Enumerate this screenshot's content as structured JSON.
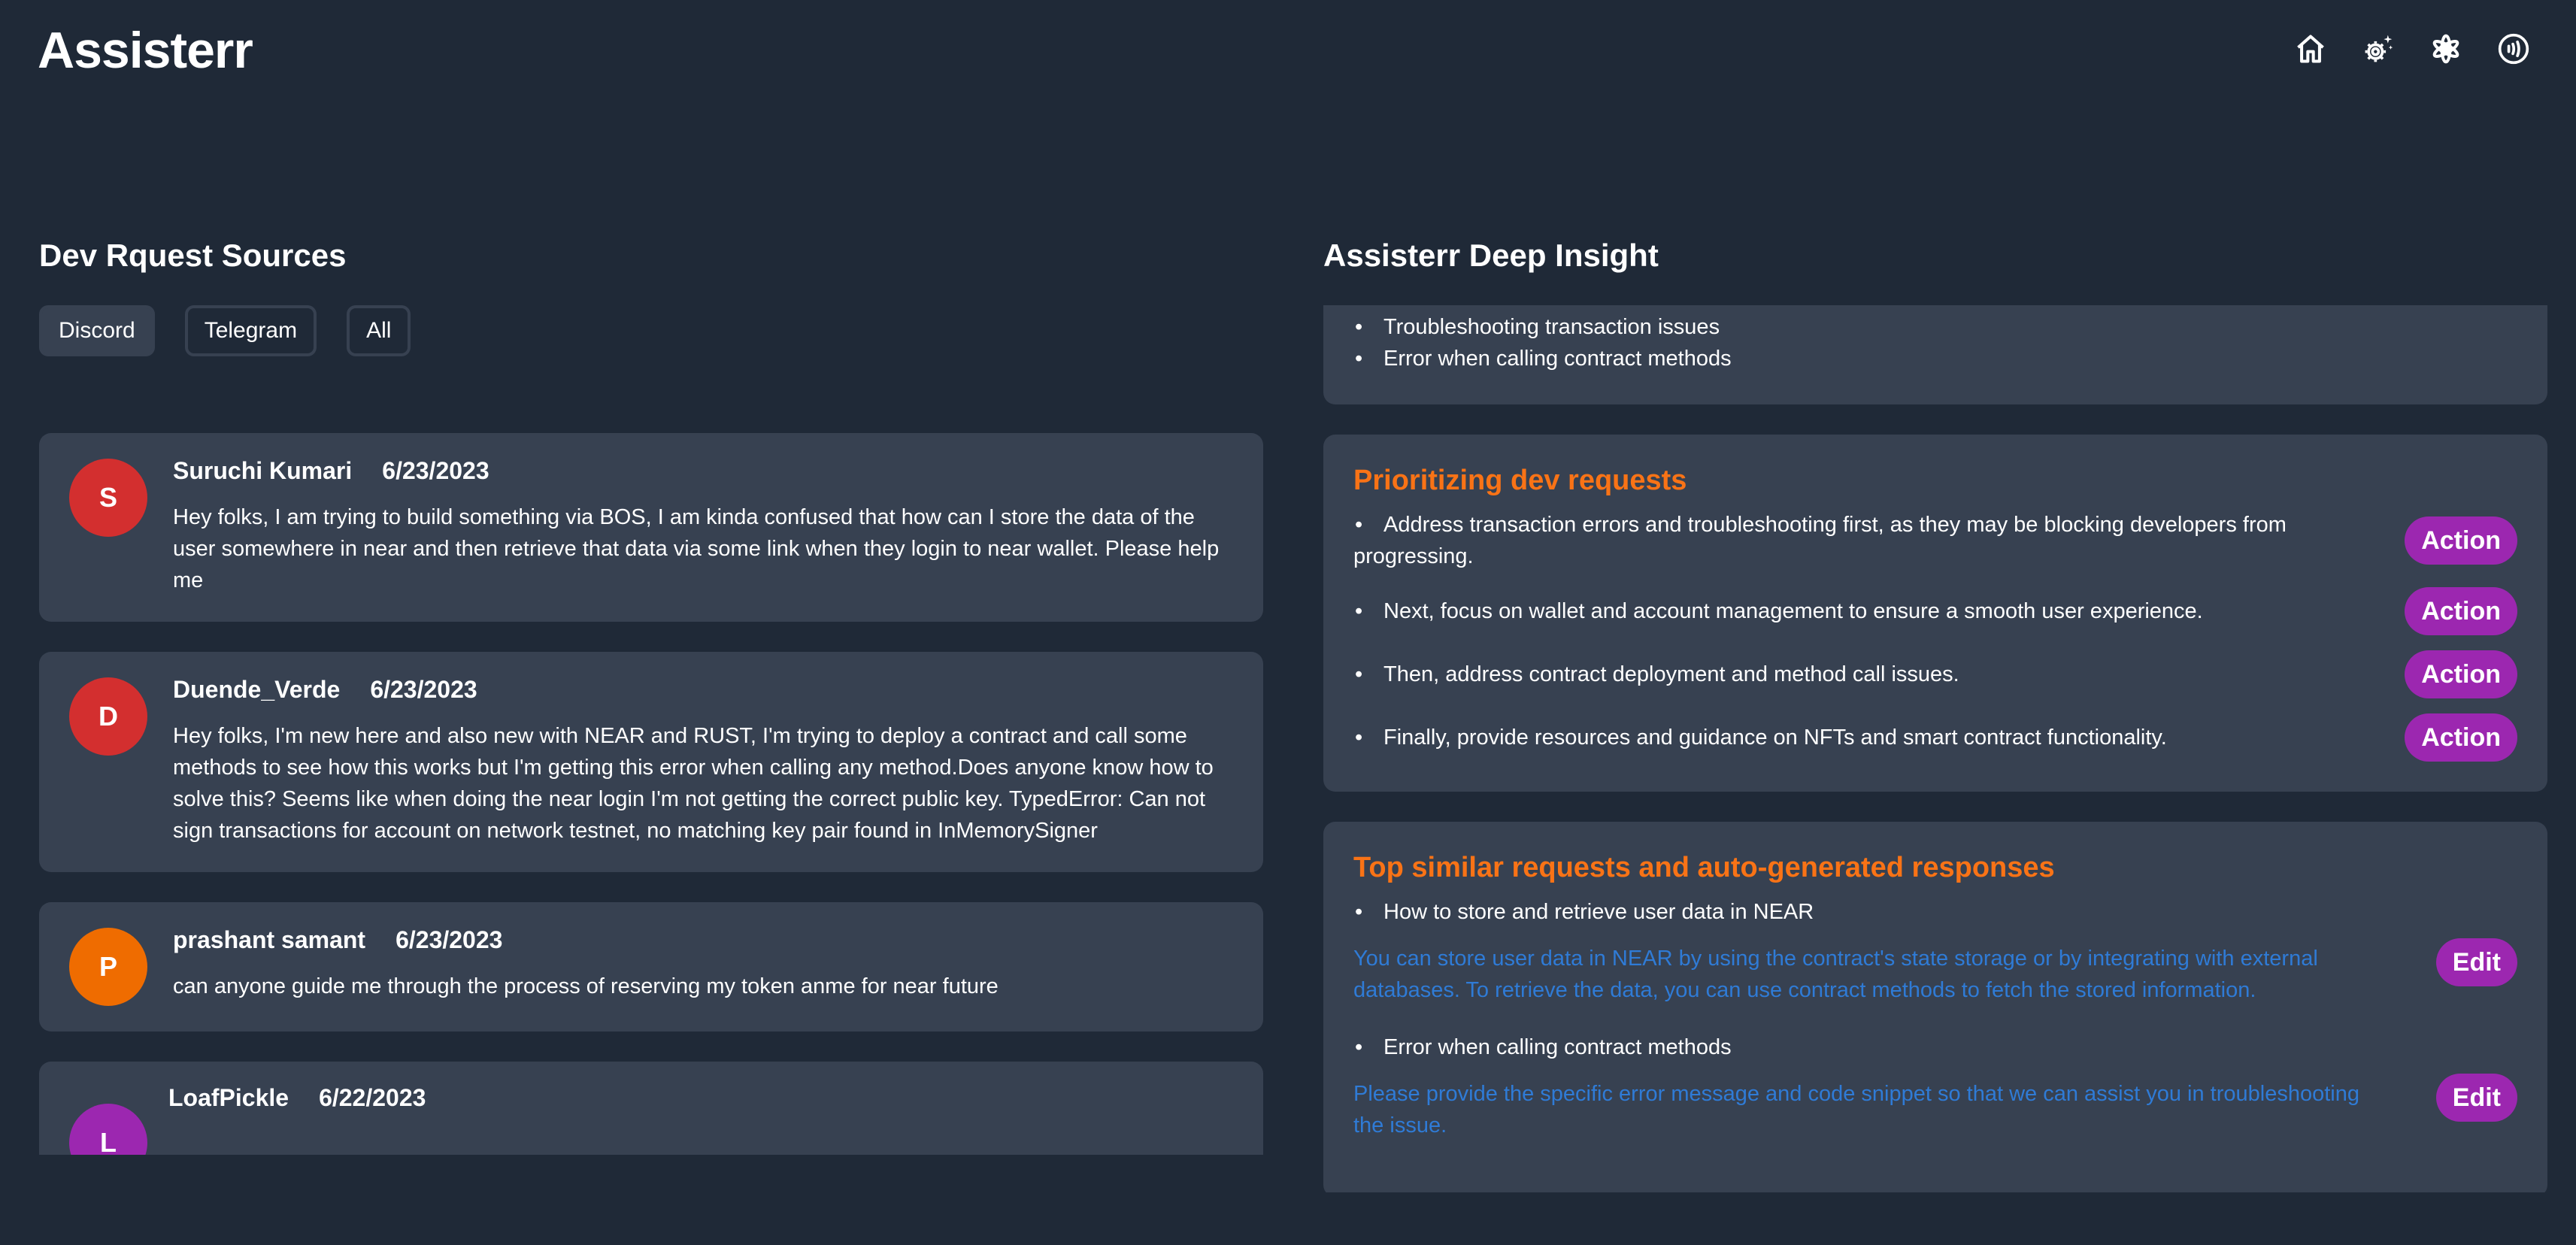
{
  "app": {
    "title": "Assisterr",
    "nav_icons": [
      "home-icon",
      "settings-sparkle-icon",
      "atom-flower-icon",
      "contactless-icon"
    ]
  },
  "left": {
    "title": "Dev Rquest Sources",
    "filters": [
      {
        "label": "Discord",
        "active": true
      },
      {
        "label": "Telegram",
        "active": false
      },
      {
        "label": "All",
        "active": false
      }
    ],
    "messages": [
      {
        "initial": "S",
        "avatar_color": "#d32f2f",
        "name": "Suruchi Kumari",
        "date": "6/23/2023",
        "text": "Hey folks, I am trying to build something via BOS, I am kinda confused that how can I store the data of the user somewhere in near and then retrieve that data via some link when they login to near wallet. Please help me"
      },
      {
        "initial": "D",
        "avatar_color": "#d32f2f",
        "name": "Duende_Verde",
        "date": "6/23/2023",
        "text": "Hey folks, I'm new here and also new with NEAR and RUST, I'm trying to deploy a contract and call some methods to see how this works but I'm getting this error when calling any method.Does anyone know how to solve this? Seems like when doing the near login I'm not getting the correct public key. TypedError: Can not sign transactions for account on network testnet, no matching key pair found in InMemorySigner"
      },
      {
        "initial": "P",
        "avatar_color": "#ef6c00",
        "name": "prashant samant",
        "date": "6/23/2023",
        "text": "can anyone guide me through the process of reserving my token anme for near future"
      },
      {
        "initial": "L",
        "avatar_color": "#9c27b0",
        "name": "LoafPickle",
        "date": "6/22/2023",
        "text": ""
      }
    ]
  },
  "right": {
    "title": "Assisterr Deep Insight",
    "topics_partial": [
      "Troubleshooting transaction issues",
      "Error when calling contract methods"
    ],
    "prioritizing": {
      "title": "Prioritizing dev requests",
      "items": [
        {
          "text": "Address transaction errors and troubleshooting first, as they may be blocking developers from progressing.",
          "button": "Action"
        },
        {
          "text": "Next, focus on wallet and account management to ensure a smooth user experience.",
          "button": "Action"
        },
        {
          "text": "Then, address contract deployment and method call issues.",
          "button": "Action"
        },
        {
          "text": "Finally, provide resources and guidance on NFTs and smart contract functionality.",
          "button": "Action"
        }
      ]
    },
    "similar": {
      "title": "Top similar requests and auto-generated responses",
      "items": [
        {
          "request": "How to store and retrieve user data in NEAR",
          "response": "You can store user data in NEAR by using the contract's state storage or by integrating with external databases. To retrieve the data, you can use contract methods to fetch the stored information.",
          "button": "Edit"
        },
        {
          "request": "Error when calling contract methods",
          "response": "Please provide the specific error message and code snippet so that we can assist you in troubleshooting the issue.",
          "button": "Edit"
        }
      ]
    }
  },
  "colors": {
    "background": "#1f2937",
    "card": "#374151",
    "accent_orange": "#f97316",
    "button_purple": "#9c27b0",
    "response_blue": "#2f7bd6"
  }
}
